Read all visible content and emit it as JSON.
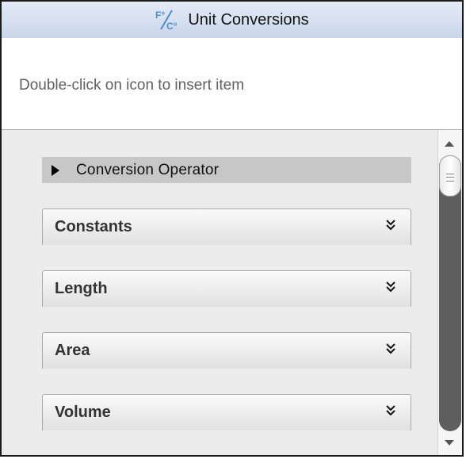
{
  "panel": {
    "title": "Unit Conversions",
    "title_icon": "fahrenheit-celsius-icon",
    "hint": "Double-click on icon to insert item"
  },
  "catalog": {
    "operator_label": "Conversion Operator",
    "categories": [
      {
        "label": "Constants",
        "icon": "double-chevron-down-icon"
      },
      {
        "label": "Length",
        "icon": "double-chevron-down-icon"
      },
      {
        "label": "Area",
        "icon": "double-chevron-down-icon"
      },
      {
        "label": "Volume",
        "icon": "double-chevron-down-icon"
      }
    ]
  },
  "colors": {
    "titlebar": "#c9d6ea",
    "icon_accent": "#4a90c8",
    "operator_bar": "#c7c7c7",
    "scroll_track": "#5e5e5e"
  }
}
